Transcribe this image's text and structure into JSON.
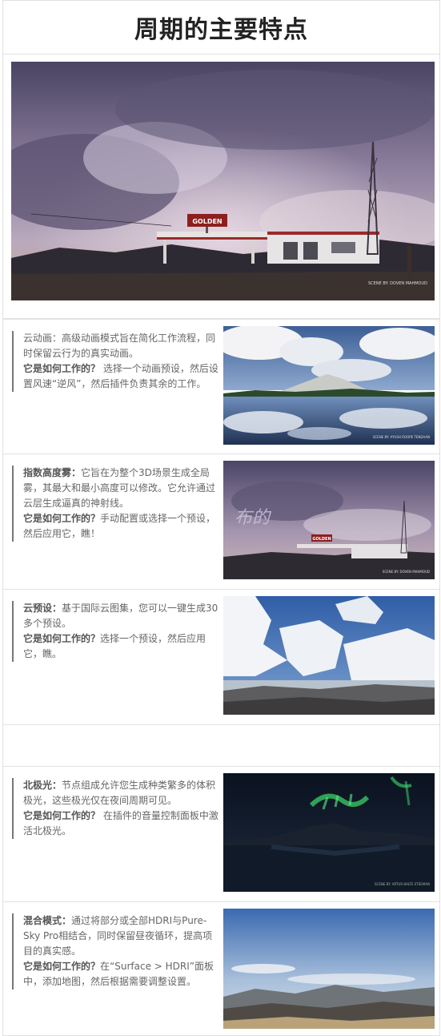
{
  "page": {
    "title": "周期的主要特点"
  },
  "hero": {
    "credit": "SCENE BY: DOVEN MAHMOUD",
    "sign": "GOLDEN"
  },
  "features": [
    {
      "name": "云动画",
      "name_sep": "：",
      "desc": "高级动画模式旨在简化工作流程，同时保留云行为的真实动画。",
      "how_label": "它是如何工作的？",
      "how": " 选择一个动画预设，然后设置风速“逆风”，然后插件负责其余的工作。",
      "credit": "SCENE BY: AYUSH ROOPE TENDAAN"
    },
    {
      "name": "指数高度雾",
      "name_sep": "：",
      "desc": "它旨在为整个3D场景生成全局雾，其最大和最小高度可以修改。它允许通过云层生成逼真的神射线。",
      "how_label": "它是如何工作的？",
      "how": "手动配置或选择一个预设，然后应用它，瞧！",
      "overlay": "布的",
      "sign": "GOLDEN",
      "credit": "SCENE BY: DOVEN MAHMOUD"
    },
    {
      "name": "云预设",
      "name_sep": "：",
      "desc": "基于国际云图集，您可以一键生成30多个预设。",
      "how_label": "它是如何工作的？",
      "how": "选择一个预设，然后应用它，瞧。"
    },
    {
      "name": "北极光",
      "name_sep": "：",
      "desc": "节点组成允许您生成种类繁多的体积极光，这些极光仅在夜间周期可见。",
      "how_label": "它是如何工作的？",
      "how": " 在插件的音量控制面板中激活北极光。",
      "credit": "SCENE BY: ARTUR BALTE STEEMAN"
    },
    {
      "name": "混合模式",
      "name_sep": "：",
      "desc": "通过将部分或全部HDRI与Pure-Sky Pro相结合，同时保留昼夜循环，提高项目的真实感。",
      "how_label": "它是如何工作的？",
      "how": "在“Surface > HDRI”面板中，添加地图，然后根据需要调整设置。"
    }
  ]
}
